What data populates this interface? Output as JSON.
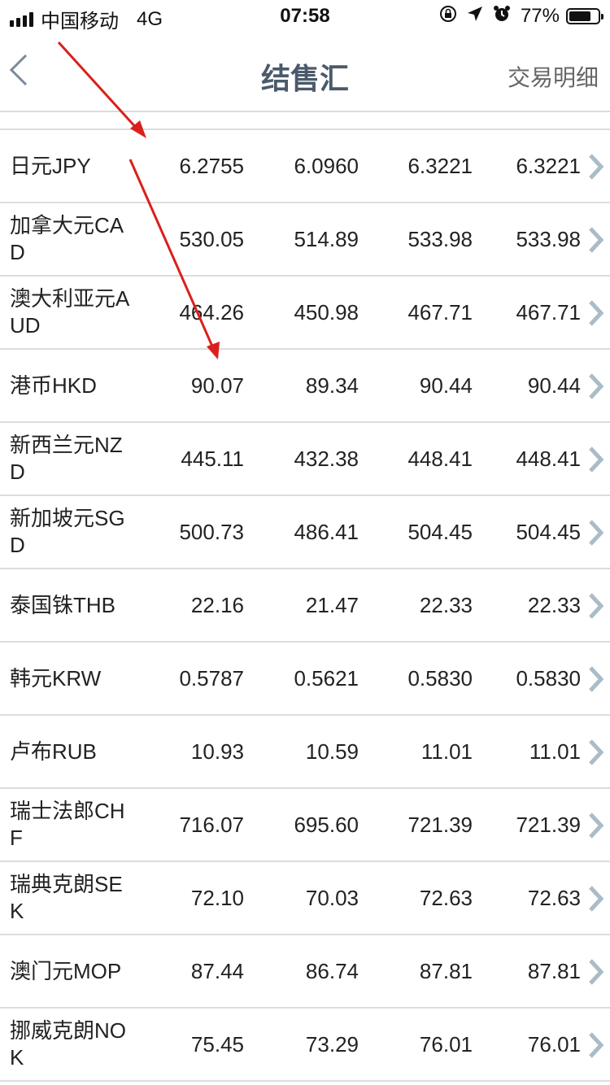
{
  "status_bar": {
    "carrier": "中国移动",
    "network": "4G",
    "time": "07:58",
    "battery_percent": "77%",
    "battery_level": 0.77
  },
  "nav": {
    "title": "结售汇",
    "right_action": "交易明细"
  },
  "rows": [
    {
      "name": "日元JPY",
      "v1": "6.2755",
      "v2": "6.0960",
      "v3": "6.3221",
      "v4": "6.3221"
    },
    {
      "name": "加拿大元CAD",
      "v1": "530.05",
      "v2": "514.89",
      "v3": "533.98",
      "v4": "533.98"
    },
    {
      "name": "澳大利亚元AUD",
      "v1": "464.26",
      "v2": "450.98",
      "v3": "467.71",
      "v4": "467.71"
    },
    {
      "name": "港币HKD",
      "v1": "90.07",
      "v2": "89.34",
      "v3": "90.44",
      "v4": "90.44"
    },
    {
      "name": "新西兰元NZD",
      "v1": "445.11",
      "v2": "432.38",
      "v3": "448.41",
      "v4": "448.41"
    },
    {
      "name": "新加坡元SGD",
      "v1": "500.73",
      "v2": "486.41",
      "v3": "504.45",
      "v4": "504.45"
    },
    {
      "name": "泰国铢THB",
      "v1": "22.16",
      "v2": "21.47",
      "v3": "22.33",
      "v4": "22.33"
    },
    {
      "name": "韩元KRW",
      "v1": "0.5787",
      "v2": "0.5621",
      "v3": "0.5830",
      "v4": "0.5830"
    },
    {
      "name": "卢布RUB",
      "v1": "10.93",
      "v2": "10.59",
      "v3": "11.01",
      "v4": "11.01"
    },
    {
      "name": "瑞士法郎CHF",
      "v1": "716.07",
      "v2": "695.60",
      "v3": "721.39",
      "v4": "721.39"
    },
    {
      "name": "瑞典克朗SEK",
      "v1": "72.10",
      "v2": "70.03",
      "v3": "72.63",
      "v4": "72.63"
    },
    {
      "name": "澳门元MOP",
      "v1": "87.44",
      "v2": "86.74",
      "v3": "87.81",
      "v4": "87.81"
    },
    {
      "name": "挪威克朗NOK",
      "v1": "75.45",
      "v2": "73.29",
      "v3": "76.01",
      "v4": "76.01"
    }
  ],
  "colors": {
    "nav_title": "#4a5a6a",
    "chevron": "#a9bcc8",
    "divider": "#dcdcdc",
    "annotation_arrow": "#d9201c"
  },
  "icons": {
    "back": "chevron-left-icon",
    "row_arrow": "chevron-right-icon",
    "rotation_lock": "rotation-lock-icon",
    "location": "location-arrow-icon",
    "alarm": "alarm-icon",
    "battery": "battery-icon",
    "signal": "signal-bars-icon"
  }
}
